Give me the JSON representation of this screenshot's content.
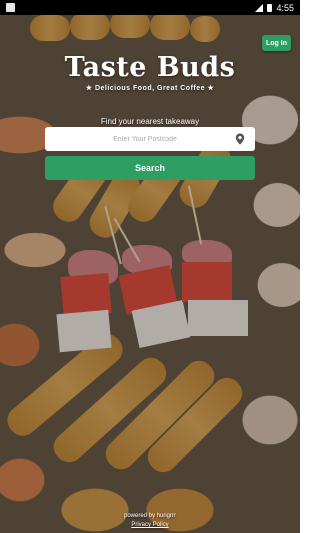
{
  "status_bar": {
    "time": "4:55"
  },
  "header": {
    "login_label": "Log In"
  },
  "brand": {
    "name": "Taste Buds",
    "tagline": "★ Delicious Food, Great Coffee ★"
  },
  "search": {
    "prompt": "Find your nearest takeaway",
    "placeholder": "Enter Your Postcode",
    "value": "",
    "button_label": "Search"
  },
  "footer": {
    "powered_by": "powered by hungrrr",
    "privacy_label": "Privacy Policy"
  },
  "colors": {
    "accent": "#2e9e62",
    "status_bar": "#000000"
  },
  "icons": {
    "location": "map-pin-icon"
  }
}
